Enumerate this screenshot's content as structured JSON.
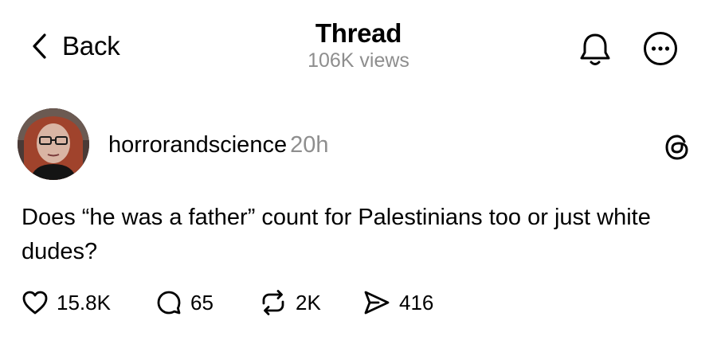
{
  "nav": {
    "back_label": "Back",
    "title": "Thread",
    "views": "106K views"
  },
  "post": {
    "author": "horrorandscience",
    "time": "20h",
    "text": "Does “he was a father” count for Palestinians too or just white dudes?",
    "stats": {
      "likes": "15.8K",
      "replies": "65",
      "reposts": "2K",
      "shares": "416"
    }
  },
  "icons": {
    "back": "chevron-left-icon",
    "bell": "bell-icon",
    "more": "more-circle-icon",
    "threads": "threads-logo-icon",
    "like": "heart-icon",
    "reply": "comment-icon",
    "repost": "repost-icon",
    "share": "send-icon"
  },
  "colors": {
    "text": "#000000",
    "secondary": "#8e8e8e",
    "background": "#ffffff"
  }
}
